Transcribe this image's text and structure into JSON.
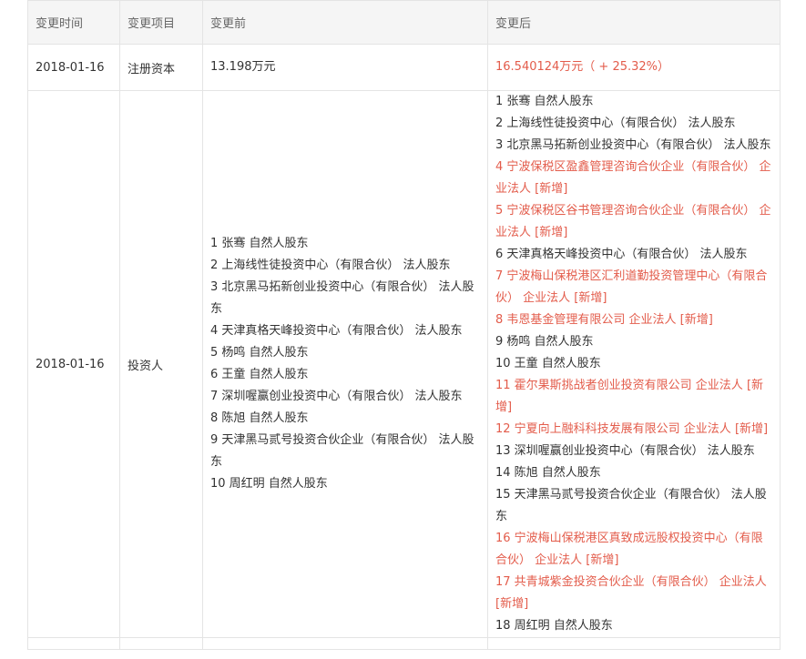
{
  "table": {
    "headers": {
      "time": "变更时间",
      "item": "变更项目",
      "before": "变更前",
      "after": "变更后"
    },
    "rows": [
      {
        "time": "2018-01-16",
        "item": "注册资本",
        "before": [
          "13.198万元"
        ],
        "after": [
          "16.540124万元（ + 25.32%）"
        ],
        "after_highlight": [
          true
        ]
      },
      {
        "time": "2018-01-16",
        "item": "投资人",
        "before": [
          "1 张骞 自然人股东",
          "2 上海线性徒投资中心（有限合伙） 法人股东",
          "3 北京黑马拓新创业投资中心（有限合伙） 法人股东",
          "4 天津真格天峰投资中心（有限合伙） 法人股东",
          "5 杨鸣 自然人股东",
          "6 王童 自然人股东",
          "7 深圳喔赢创业投资中心（有限合伙） 法人股东",
          "8 陈旭 自然人股东",
          "9 天津黑马贰号投资合伙企业（有限合伙） 法人股东",
          "10 周红明 自然人股东"
        ],
        "after": [
          "1 张骞 自然人股东",
          "2 上海线性徒投资中心（有限合伙） 法人股东",
          "3 北京黑马拓新创业投资中心（有限合伙） 法人股东",
          "4 宁波保税区盈鑫管理咨询合伙企业（有限合伙） 企业法人 [新增]",
          "5 宁波保税区谷书管理咨询合伙企业（有限合伙） 企业法人 [新增]",
          "6 天津真格天峰投资中心（有限合伙） 法人股东",
          "7 宁波梅山保税港区汇利道勤投资管理中心（有限合伙） 企业法人 [新增]",
          "8 韦恩基金管理有限公司 企业法人 [新增]",
          "9 杨鸣 自然人股东",
          "10 王童 自然人股东",
          "11 霍尔果斯挑战者创业投资有限公司 企业法人 [新增]",
          "12 宁夏向上融科科技发展有限公司 企业法人 [新增]",
          "13 深圳喔赢创业投资中心（有限合伙） 法人股东",
          "14 陈旭 自然人股东",
          "15 天津黑马贰号投资合伙企业（有限合伙） 法人股东",
          "16 宁波梅山保税港区真致成远股权投资中心（有限合伙） 企业法人 [新增]",
          "17 共青城紫金投资合伙企业（有限合伙） 企业法人 [新增]",
          "18 周红明 自然人股东"
        ],
        "after_highlight": [
          false,
          false,
          false,
          true,
          true,
          false,
          true,
          true,
          false,
          false,
          true,
          true,
          false,
          false,
          false,
          true,
          true,
          false
        ]
      }
    ]
  },
  "colors": {
    "added": "#e35c4b",
    "header_bg": "#f5f5f5",
    "border": "#e4e4e4",
    "text": "#333333"
  }
}
